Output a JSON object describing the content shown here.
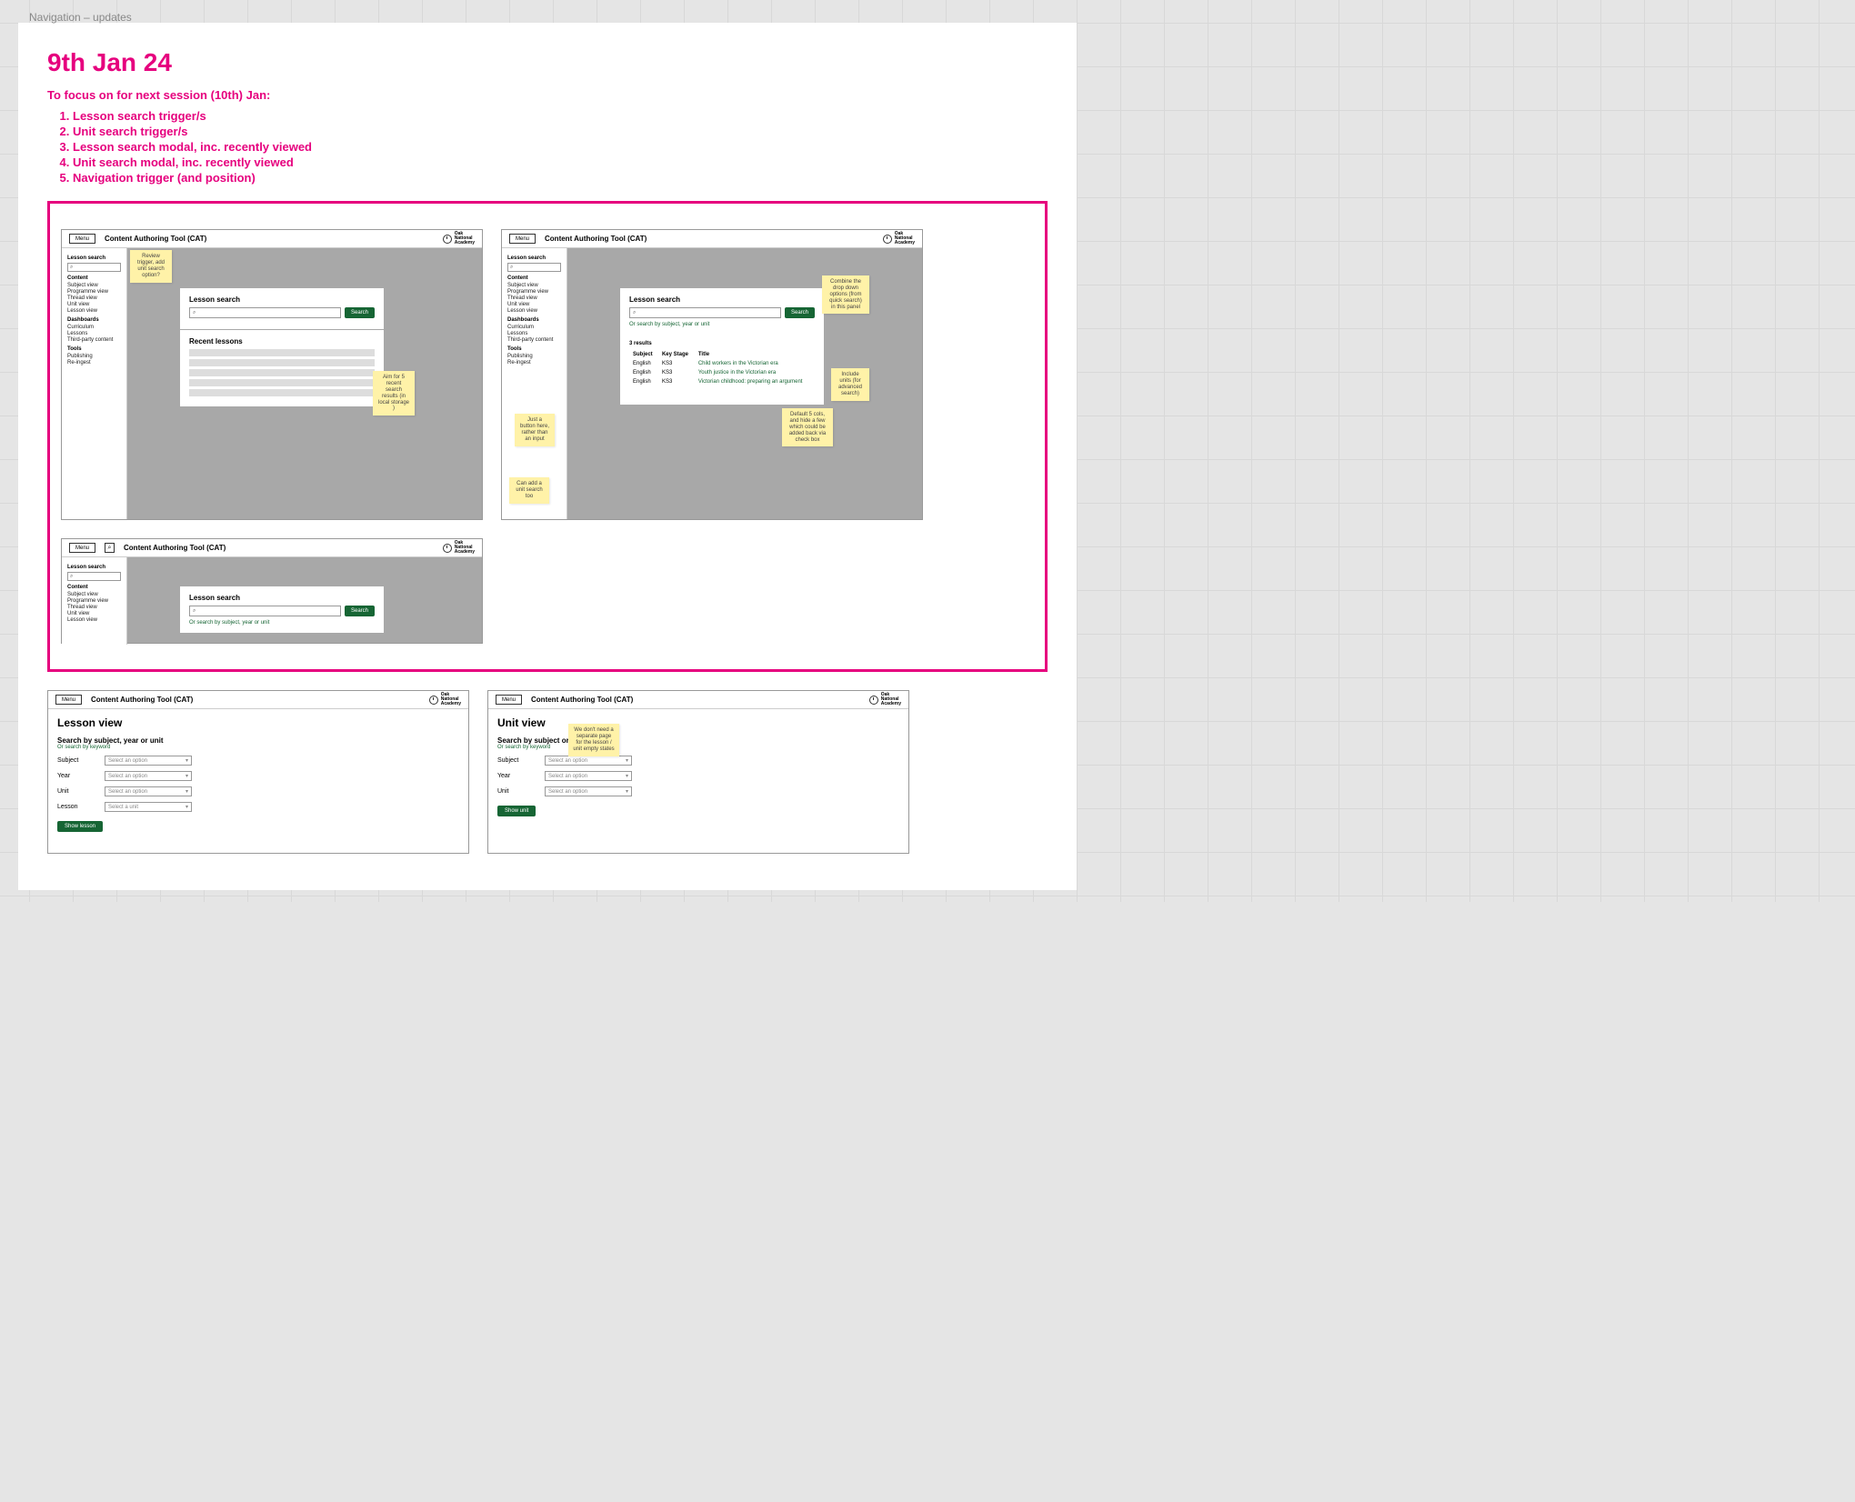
{
  "frameLabel": "Navigation – updates",
  "title": "9th Jan 24",
  "focusHeading": "To focus on for next session (10th) Jan:",
  "focusItems": [
    "Lesson search trigger/s",
    "Unit search trigger/s",
    "Lesson search modal, inc. recently viewed",
    "Unit search modal, inc. recently viewed",
    "Navigation trigger (and position)"
  ],
  "menuLabel": "Menu",
  "appTitle": "Content Authoring Tool (CAT)",
  "logoText": "Oak\nNational\nAcademy",
  "sidebar": {
    "lessonSearch": "Lesson search",
    "searchGlyph": "⌕",
    "content": "Content",
    "items1": [
      "Subject view",
      "Programme view",
      "Thread view",
      "Unit view",
      "Lesson view"
    ],
    "dashboards": "Dashboards",
    "items2": [
      "Curriculum",
      "Lessons",
      "Third-party content"
    ],
    "tools": "Tools",
    "items3": [
      "Publishing",
      "Re-ingest"
    ]
  },
  "panel1": {
    "title": "Lesson search",
    "btn": "Search",
    "recent": "Recent lessons"
  },
  "sticky1": "Review trigger, add unit search option?",
  "sticky2": "Aim for 5 recent search results (in local storage )",
  "panel2": {
    "title": "Lesson search",
    "btn": "Search",
    "orLink": "Or search by subject, year or unit",
    "resultsLabel": "3 results",
    "headers": {
      "subject": "Subject",
      "ks": "Key Stage",
      "title": "Title"
    },
    "rows": [
      {
        "s": "English",
        "k": "KS3",
        "t": "Child workers in the Victorian era"
      },
      {
        "s": "English",
        "k": "KS3",
        "t": "Youth justice in the Victorian era"
      },
      {
        "s": "English",
        "k": "KS3",
        "t": "Victorian childhood: preparing an argument"
      }
    ]
  },
  "sticky3": "Combine the drop down options (from quick search) in this panel",
  "sticky4": "Include units (for advanced search)",
  "sticky5": "Default 5 cols, and hide a few which could be added back via check box",
  "sticky6": "Just a button here, rather than an input",
  "sticky7": "Can add a unit search too",
  "panel3": {
    "title": "Lesson search",
    "btn": "Search",
    "orLink": "Or search by subject, year or unit"
  },
  "lessonView": {
    "title": "Lesson view",
    "sub": "Search by subject, year or unit",
    "orLink": "Or search by keyword",
    "fields": [
      "Subject",
      "Year",
      "Unit",
      "Lesson"
    ],
    "placeholder1": "Select an option",
    "placeholder2": "Select a unit",
    "btn": "Show lesson"
  },
  "unitView": {
    "title": "Unit view",
    "sub": "Search by subject or year",
    "orLink": "Or search by keyword",
    "fields": [
      "Subject",
      "Year",
      "Unit"
    ],
    "placeholder": "Select an option",
    "btn": "Show unit"
  },
  "sticky8": "We don't need a separate page for the lesson / unit empty states"
}
